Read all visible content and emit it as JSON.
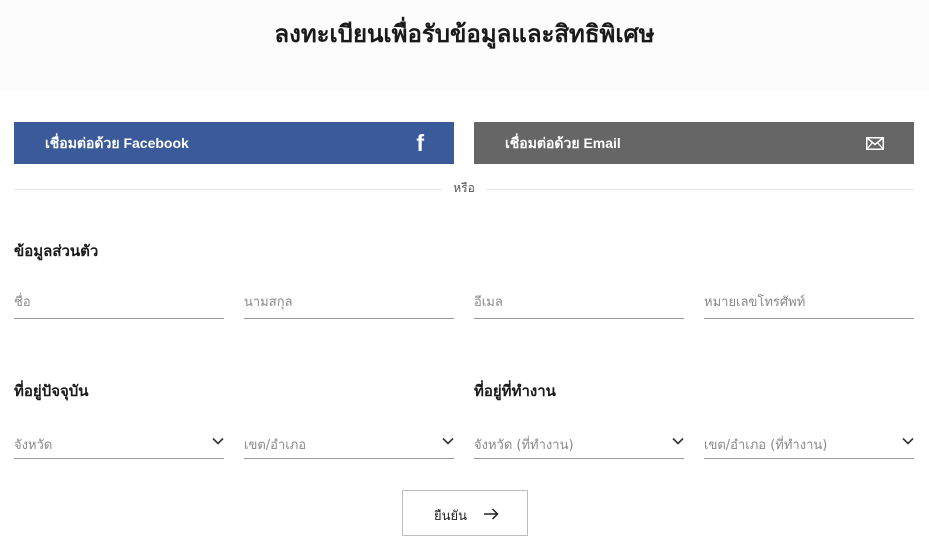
{
  "page": {
    "title": "ลงทะเบียนเพื่อรับข้อมูลและสิทธิพิเศษ"
  },
  "social": {
    "facebook_label": "เชื่อมต่อด้วย Facebook",
    "facebook_icon": "facebook-icon",
    "facebook_color": "#3b5a9a",
    "email_label": "เชื่อมต่อด้วย Email",
    "email_icon": "envelope-icon",
    "email_color": "#666666"
  },
  "divider": {
    "text": "หรือ"
  },
  "personal": {
    "heading": "ข้อมูลส่วนตัว",
    "first_name_placeholder": "ชื่อ",
    "last_name_placeholder": "นามสกุล",
    "email_placeholder": "อีเมล",
    "phone_placeholder": "หมายเลขโทรศัพท์"
  },
  "home_address": {
    "heading": "ที่อยู่ปัจจุบัน",
    "province_placeholder": "จังหวัด",
    "district_placeholder": "เขต/อำเภอ"
  },
  "work_address": {
    "heading": "ที่อยู่ที่ทำงาน",
    "province_placeholder": "จังหวัด (ที่ทำงาน)",
    "district_placeholder": "เขต/อำเภอ (ที่ทำงาน)"
  },
  "submit": {
    "label": "ยืนยัน",
    "icon": "arrow-right-icon"
  }
}
